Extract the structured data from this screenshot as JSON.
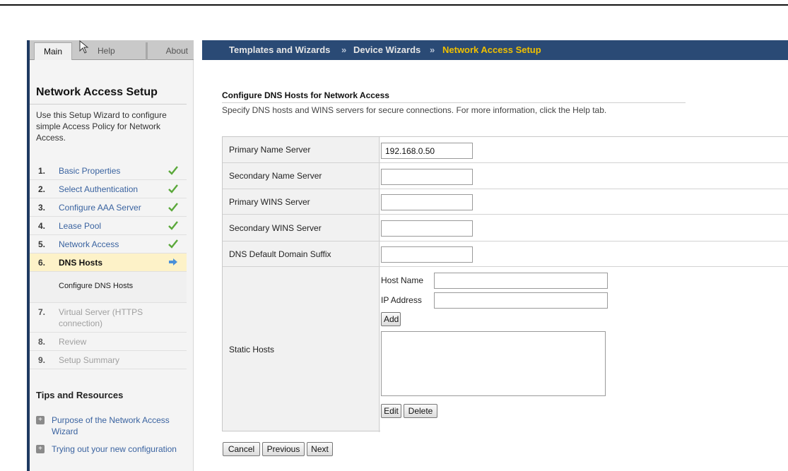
{
  "tabs": {
    "main": "Main",
    "help": "Help",
    "about": "About"
  },
  "breadcrumb": {
    "items": [
      "Templates and Wizards",
      "Device Wizards"
    ],
    "separator": "»",
    "current": "Network Access Setup"
  },
  "sidebar": {
    "title": "Network Access Setup",
    "description": "Use this Setup Wizard to configure simple Access Policy for Network Access.",
    "steps": [
      {
        "num": "1.",
        "label": "Basic Properties",
        "status": "done"
      },
      {
        "num": "2.",
        "label": "Select Authentication",
        "status": "done"
      },
      {
        "num": "3.",
        "label": "Configure AAA Server",
        "status": "done"
      },
      {
        "num": "4.",
        "label": "Lease Pool",
        "status": "done"
      },
      {
        "num": "5.",
        "label": "Network Access",
        "status": "done"
      },
      {
        "num": "6.",
        "label": "DNS Hosts",
        "status": "current"
      },
      {
        "num": "",
        "label": "Configure DNS Hosts",
        "status": "substep"
      },
      {
        "num": "7.",
        "label": "Virtual Server (HTTPS connection)",
        "status": "pending"
      },
      {
        "num": "8.",
        "label": "Review",
        "status": "pending"
      },
      {
        "num": "9.",
        "label": "Setup Summary",
        "status": "pending"
      }
    ],
    "tips_title": "Tips and Resources",
    "tips": [
      "Purpose of the Network Access Wizard",
      "Trying out your new configuration"
    ]
  },
  "main": {
    "section_title": "Configure DNS Hosts for Network Access",
    "section_desc": "Specify DNS hosts and WINS servers for secure connections. For more information, click the Help tab.",
    "fields": {
      "primary_name_server": {
        "label": "Primary Name Server",
        "value": "192.168.0.50"
      },
      "secondary_name_server": {
        "label": "Secondary Name Server",
        "value": ""
      },
      "primary_wins_server": {
        "label": "Primary WINS Server",
        "value": ""
      },
      "secondary_wins_server": {
        "label": "Secondary WINS Server",
        "value": ""
      },
      "dns_default_domain_suffix": {
        "label": "DNS Default Domain Suffix",
        "value": ""
      }
    },
    "static_hosts": {
      "label": "Static Hosts",
      "host_name_label": "Host Name",
      "host_name_value": "",
      "ip_address_label": "IP Address",
      "ip_address_value": "",
      "add_label": "Add",
      "edit_label": "Edit",
      "delete_label": "Delete"
    },
    "buttons": {
      "cancel": "Cancel",
      "previous": "Previous",
      "next": "Next"
    }
  },
  "colors": {
    "breadcrumb_bg": "#2a4a75",
    "breadcrumb_current": "#f0c000",
    "link": "#3a63a0",
    "check": "#5aa83a",
    "current_step_bg": "#fdf2c8"
  },
  "icons": {
    "done": "check-icon",
    "current": "arrow-right-icon",
    "tip": "plus-box-icon",
    "cursor": "mouse-cursor-icon"
  }
}
